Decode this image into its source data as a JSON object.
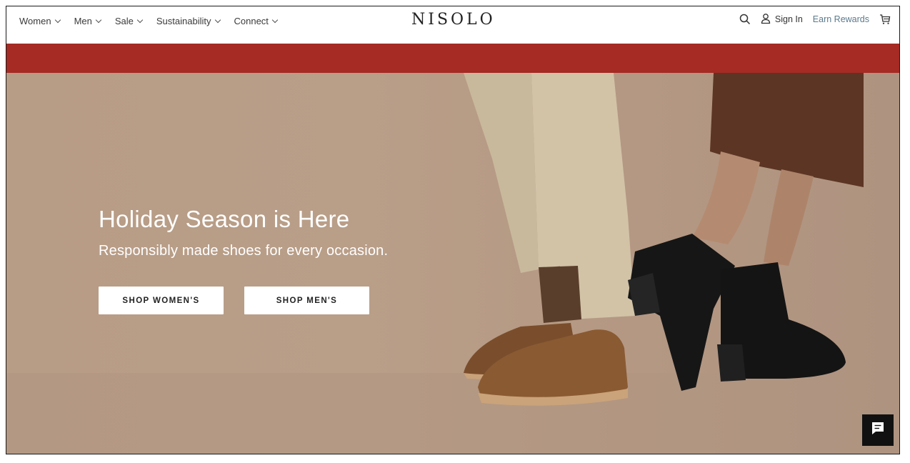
{
  "header": {
    "nav": [
      {
        "label": "Women"
      },
      {
        "label": "Men"
      },
      {
        "label": "Sale"
      },
      {
        "label": "Sustainability"
      },
      {
        "label": "Connect"
      }
    ],
    "logo": "NISOLO",
    "sign_in": "Sign In",
    "earn_rewards": "Earn Rewards",
    "icons": [
      "search-icon",
      "user-icon",
      "cart-icon"
    ]
  },
  "promo": {
    "text": "",
    "color": "#a52b24"
  },
  "hero": {
    "title": "Holiday Season is Here",
    "subtitle": "Responsibly made shoes for every occasion.",
    "buttons": {
      "women": "SHOP WOMEN'S",
      "men": "SHOP MEN'S"
    }
  },
  "chat": {
    "icon": "chat-icon"
  }
}
